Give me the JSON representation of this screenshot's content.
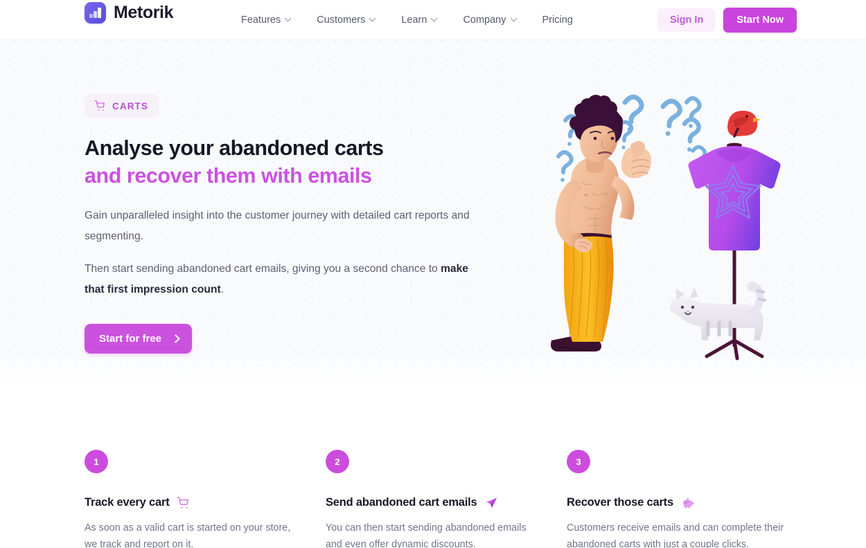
{
  "brand": {
    "name": "Metorik",
    "logo_icon": "bar-chart-logo-icon",
    "logo_color": "#6558e0"
  },
  "nav": {
    "items": [
      {
        "label": "Features",
        "has_dropdown": true
      },
      {
        "label": "Customers",
        "has_dropdown": true
      },
      {
        "label": "Learn",
        "has_dropdown": true
      },
      {
        "label": "Company",
        "has_dropdown": true
      },
      {
        "label": "Pricing",
        "has_dropdown": false
      }
    ]
  },
  "header_actions": {
    "sign_in_label": "Sign In",
    "start_now_label": "Start Now",
    "sign_in_bg": "#faeffb",
    "sign_in_color": "#bb5bd4",
    "start_now_bg": "#c944dc"
  },
  "hero": {
    "badge": {
      "label": "CARTS",
      "icon": "shopping-cart-icon",
      "color": "#b44fd0",
      "bg": "#f7f1fa"
    },
    "title_line1": "Analyse your abandoned carts",
    "title_line2": "and recover them with emails",
    "title_accent_color": "#cb52df",
    "paragraph1": "Gain unparalleled insight into the customer journey with detailed cart reports and segmenting.",
    "paragraph2_prefix": "Then start sending abandoned cart emails, giving you a second chance to ",
    "paragraph2_bold": "make that first impression count",
    "paragraph2_suffix": ".",
    "cta_label": "Start for free",
    "cta_icon": "chevron-right-icon",
    "cta_bg": "#cb52df",
    "illustration_name": "confused-shopper-tshirt-mannequin-illustration",
    "background_color": "#f9fafc"
  },
  "steps": [
    {
      "number": "1",
      "title": "Track every cart",
      "emoji": "shopping-cart-icon",
      "description": "As soon as a valid cart is started on your store, we track and report on it."
    },
    {
      "number": "2",
      "title": "Send abandoned cart emails",
      "emoji": "paper-plane-icon",
      "description": "You can then start sending abandoned emails and even offer dynamic discounts."
    },
    {
      "number": "3",
      "title": "Recover those carts",
      "emoji": "piggy-bank-icon",
      "description": "Customers receive emails and can complete their abandoned carts with just a couple clicks."
    }
  ]
}
